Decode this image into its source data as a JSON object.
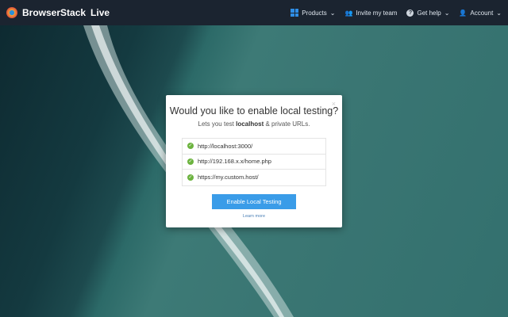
{
  "nav": {
    "brand": "BrowserStack",
    "product": "Live",
    "items": [
      {
        "label": "Products",
        "icon": "grid-icon"
      },
      {
        "label": "Invite my team",
        "icon": "invite-user-icon"
      },
      {
        "label": "Get help",
        "icon": "help-icon"
      },
      {
        "label": "Account",
        "icon": "user-icon"
      }
    ]
  },
  "modal": {
    "title": "Would you like to enable local testing?",
    "sub_prefix": "Lets you test ",
    "sub_bold": "localhost",
    "sub_suffix": " & private URLs.",
    "urls": [
      "http://localhost:3000/",
      "http://192.168.x.x/home.php",
      "https://my.custom.host/"
    ],
    "button": "Enable Local Testing",
    "learn_more": "Learn more",
    "close": "×"
  }
}
